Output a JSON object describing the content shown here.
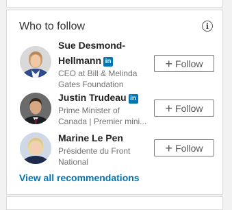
{
  "widget": {
    "title": "Who to follow",
    "info_icon": "info-icon",
    "view_all": "View all recommendations"
  },
  "people": [
    {
      "name_line1": "Sue Desmond-",
      "name_line2": "Hellmann",
      "headline_line1": "CEO at Bill & Melinda",
      "headline_line2": "Gates Foundation",
      "follow_label": "Follow",
      "badge": "in"
    },
    {
      "name_line1": "Justin Trudeau",
      "headline_line1": "Prime Minister of",
      "headline_line2": "Canada | Premier mini...",
      "follow_label": "Follow",
      "badge": "in"
    },
    {
      "name_line1": "Marine Le Pen",
      "headline_line1": "Présidente du Front",
      "headline_line2": "National",
      "follow_label": "Follow"
    }
  ],
  "colors": {
    "linkedin_blue": "#0077b5",
    "link_blue": "#0073b1",
    "page_bg": "#f2f2f2"
  }
}
